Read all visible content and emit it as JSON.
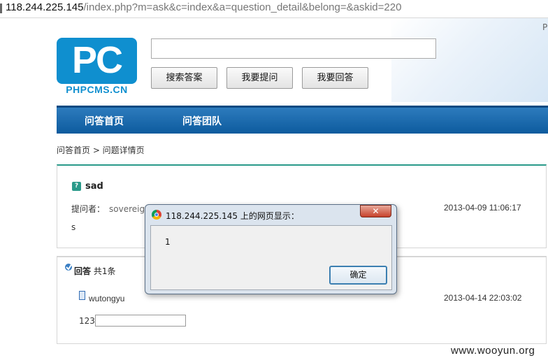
{
  "browser": {
    "url_host": "118.244.225.145",
    "url_path": "/index.php?m=ask&c=index&a=question_detail&belong=&askid=220"
  },
  "header": {
    "corner_text": "P",
    "logo_letters": "PC",
    "logo_text": "PHPCMS.CN",
    "search_value": "",
    "buttons": [
      "搜索答案",
      "我要提问",
      "我要回答"
    ]
  },
  "nav": {
    "items": [
      "问答首页",
      "问答团队"
    ]
  },
  "breadcrumb": "问答首页 > 问题详情页",
  "question": {
    "title": "sad",
    "asker_label": "提问者：",
    "asker_name": "sovereign",
    "date": "2013-04-09 11:06:17",
    "body": "s"
  },
  "answers": {
    "label": "回答",
    "count_text": "共1条",
    "items": [
      {
        "user": "wutongyu",
        "date": "2013-04-14 22:03:02",
        "content": "123"
      }
    ]
  },
  "dialog": {
    "title": "118.244.225.145 上的网页显示：",
    "message": "1",
    "ok_label": "确定",
    "close_label": "✕"
  },
  "watermark": "www.wooyun.org"
}
